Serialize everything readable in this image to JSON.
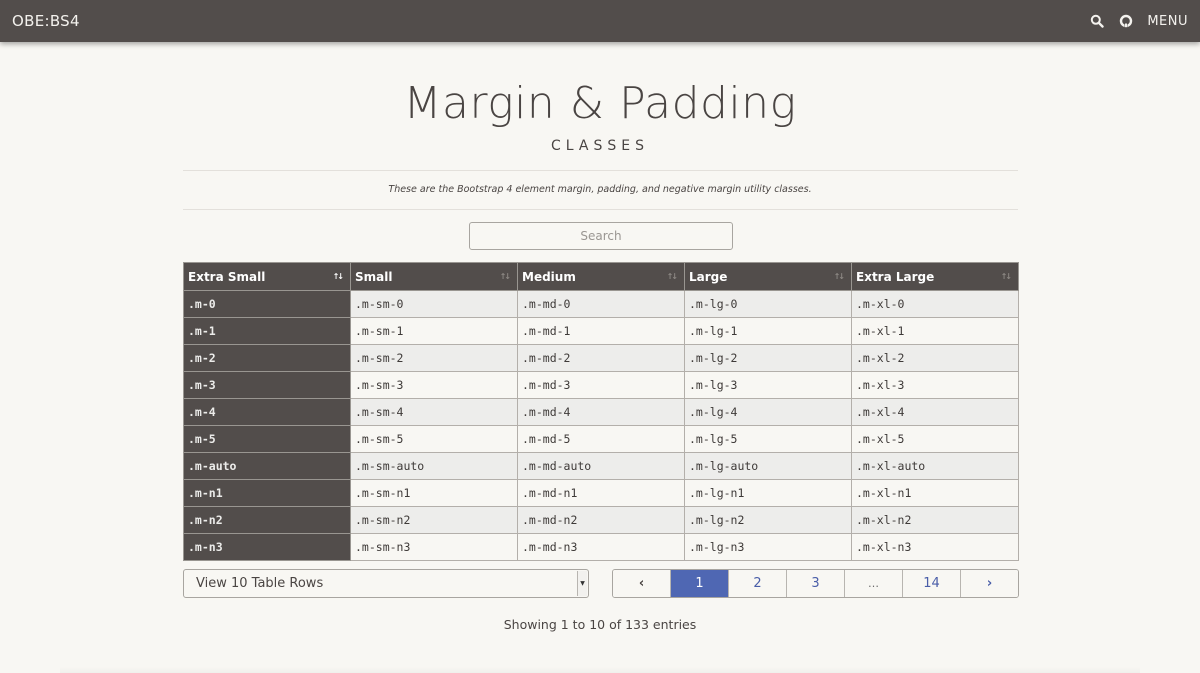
{
  "navbar": {
    "brand": "OBE:BS4",
    "icons": [
      "search-icon",
      "github-icon"
    ],
    "menu_label": "MENU"
  },
  "header": {
    "title": "Margin & Padding",
    "subtitle": "CLASSES",
    "lead": "These are the Bootstrap 4 element margin, padding, and negative margin utility classes."
  },
  "search": {
    "placeholder": "Search",
    "value": ""
  },
  "table": {
    "columns": [
      {
        "label": "Extra Small",
        "sort": "ascending"
      },
      {
        "label": "Small",
        "sort": "none"
      },
      {
        "label": "Medium",
        "sort": "none"
      },
      {
        "label": "Large",
        "sort": "none"
      },
      {
        "label": "Extra Large",
        "sort": "none"
      }
    ],
    "rows": [
      [
        ".m-0",
        ".m-sm-0",
        ".m-md-0",
        ".m-lg-0",
        ".m-xl-0"
      ],
      [
        ".m-1",
        ".m-sm-1",
        ".m-md-1",
        ".m-lg-1",
        ".m-xl-1"
      ],
      [
        ".m-2",
        ".m-sm-2",
        ".m-md-2",
        ".m-lg-2",
        ".m-xl-2"
      ],
      [
        ".m-3",
        ".m-sm-3",
        ".m-md-3",
        ".m-lg-3",
        ".m-xl-3"
      ],
      [
        ".m-4",
        ".m-sm-4",
        ".m-md-4",
        ".m-lg-4",
        ".m-xl-4"
      ],
      [
        ".m-5",
        ".m-sm-5",
        ".m-md-5",
        ".m-lg-5",
        ".m-xl-5"
      ],
      [
        ".m-auto",
        ".m-sm-auto",
        ".m-md-auto",
        ".m-lg-auto",
        ".m-xl-auto"
      ],
      [
        ".m-n1",
        ".m-sm-n1",
        ".m-md-n1",
        ".m-lg-n1",
        ".m-xl-n1"
      ],
      [
        ".m-n2",
        ".m-sm-n2",
        ".m-md-n2",
        ".m-lg-n2",
        ".m-xl-n2"
      ],
      [
        ".m-n3",
        ".m-sm-n3",
        ".m-md-n3",
        ".m-lg-n3",
        ".m-xl-n3"
      ]
    ]
  },
  "rows_select": {
    "selected": "View 10 Table Rows"
  },
  "pagination": {
    "prev": "‹",
    "pages": [
      "1",
      "2",
      "3",
      "…",
      "14"
    ],
    "active": "1",
    "next": "›"
  },
  "info": "Showing 1 to 10 of 133 entries",
  "colors": {
    "navbar": "#524d4b",
    "background": "#f8f7f3",
    "accent": "#4f67b3"
  }
}
